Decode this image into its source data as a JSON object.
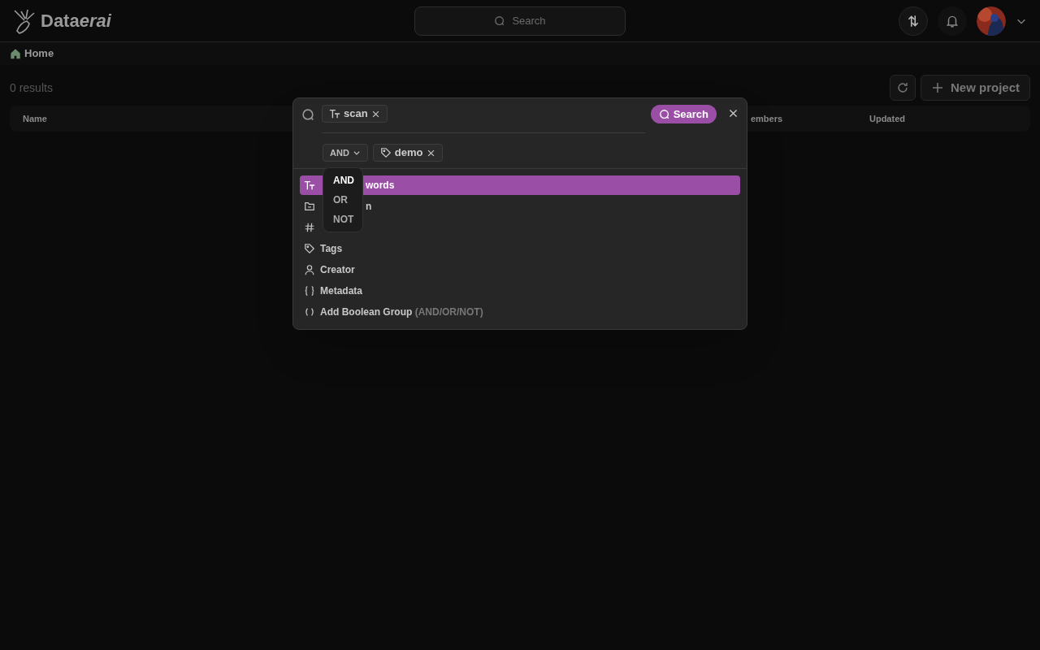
{
  "header": {
    "logo": "Data",
    "logo_italic": "erai",
    "search": {
      "placeholder": "Search"
    }
  },
  "breadcrumb": "Home",
  "results": "0 results",
  "buttons": {
    "new_project": "New project"
  },
  "table": {
    "columns": [
      "Name",
      "embers",
      "Updated"
    ]
  },
  "query": {
    "chips": [
      {
        "kind": "text",
        "label": "scan"
      }
    ],
    "operator": "AND",
    "filters": [
      {
        "kind": "tag",
        "label": "demo"
      }
    ],
    "submit": "Search"
  },
  "menu": [
    {
      "kind": "text",
      "label": "words",
      "covered": true,
      "selected": true
    },
    {
      "kind": "folder",
      "label": "n",
      "covered": true,
      "selected": false
    },
    {
      "kind": "hash",
      "selected": false
    },
    {
      "kind": "tag",
      "label": "Tags",
      "selected": false
    },
    {
      "kind": "user",
      "label": "Creator",
      "selected": false
    },
    {
      "kind": "braces",
      "label": "Metadata",
      "selected": false
    },
    {
      "kind": "parens",
      "label": "Add Boolean Group",
      "hint": "(AND/OR/NOT)",
      "selected": false
    }
  ],
  "operator_menu": [
    {
      "label": "AND",
      "selected": true
    },
    {
      "label": "OR",
      "selected": false
    },
    {
      "label": "NOT",
      "selected": false
    }
  ]
}
